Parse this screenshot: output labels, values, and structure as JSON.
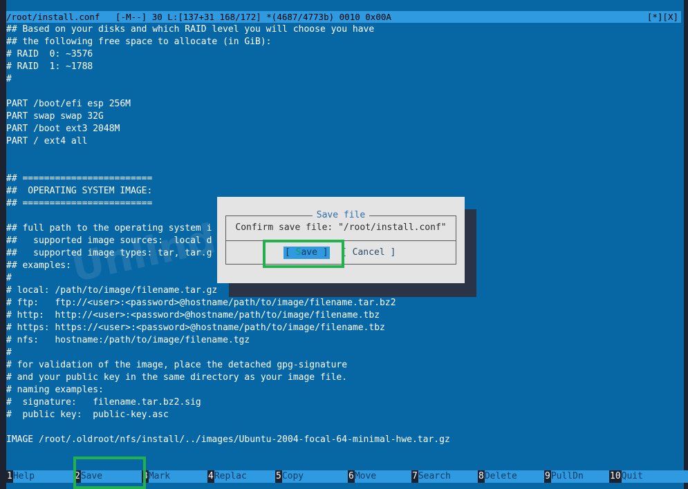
{
  "titlebar": {
    "left": "/root/install.conf   [-M--] 30 L:[137+31 168/172] *(4687/4773b) 0010 0x00A",
    "right": "[*][X]"
  },
  "lines": [
    "## Based on your disks and which RAID level you will choose you have",
    "## the following free space to allocate (in GiB):",
    "# RAID  0: ~3576",
    "# RAID  1: ~1788",
    "#",
    "",
    "PART /boot/efi esp 256M",
    "PART swap swap 32G",
    "PART /boot ext3 2048M",
    "PART / ext4 all",
    "",
    "",
    "## ========================",
    "##  OPERATING SYSTEM IMAGE:",
    "## ========================",
    "",
    "## full path to the operating system i",
    "##   supported image sources:  local d",
    "##   supported image types: tar, tar.g",
    "## examples:",
    "#",
    "# local: /path/to/image/filename.tar.gz",
    "# ftp:   ftp://<user>:<password>@hostname/path/to/image/filename.tar.bz2",
    "# http:  http://<user>:<password>@hostname/path/to/image/filename.tbz",
    "# https: https://<user>:<password>@hostname/path/to/image/filename.tbz",
    "# nfs:   hostname:/path/to/image/filename.tgz",
    "#",
    "# for validation of the image, place the detached gpg-signature",
    "# and your public key in the same directory as your image file.",
    "# naming examples:",
    "#  signature:   filename.tar.bz2.sig",
    "#  public key:  public-key.asc",
    "",
    "IMAGE /root/.oldroot/nfs/install/../images/Ubuntu-2004-focal-64-minimal-hwe.tar.gz"
  ],
  "watermark": "Unlinder.com",
  "dialog": {
    "title": "Save file",
    "message": "Confirm save file: \"/root/install.conf\"",
    "save_open": "[ ",
    "save_hot": "S",
    "save_rest": "ave ]",
    "cancel": "[ Cancel ]"
  },
  "keybar": [
    {
      "num": "1",
      "label": "Help"
    },
    {
      "num": "2",
      "label": "Save"
    },
    {
      "num": "3",
      "label": "Mark"
    },
    {
      "num": "4",
      "label": "Replac"
    },
    {
      "num": "5",
      "label": "Copy"
    },
    {
      "num": "6",
      "label": "Move"
    },
    {
      "num": "7",
      "label": "Search"
    },
    {
      "num": "8",
      "label": "Delete"
    },
    {
      "num": "9",
      "label": "PullDn"
    },
    {
      "num": "10",
      "label": "Quit"
    }
  ]
}
